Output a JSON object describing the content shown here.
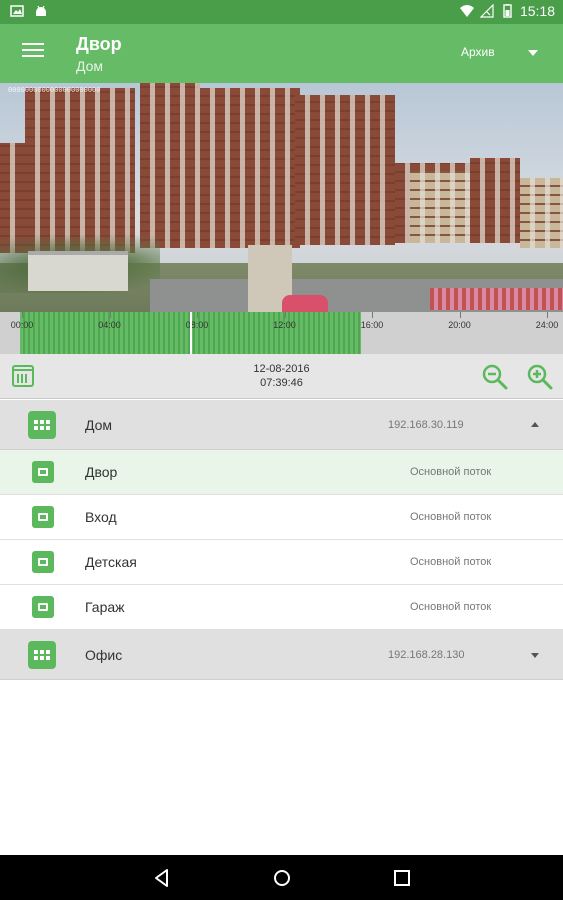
{
  "status_bar": {
    "time": "15:18",
    "icons": [
      "image-icon",
      "android-icon",
      "wifi-icon",
      "no-signal-icon",
      "battery-icon"
    ]
  },
  "app_bar": {
    "title": "Двор",
    "subtitle": "Дом",
    "archive_label": "Архив",
    "menu_icon": "hamburger-menu-icon"
  },
  "video": {
    "stamp": "0000000000000000000000"
  },
  "timeline": {
    "labels": [
      "00:00",
      "04:00",
      "08:00",
      "12:00",
      "16:00",
      "20:00",
      "24:00"
    ],
    "recording_hours": [
      0.2,
      15.5
    ],
    "cursor_hour": 7.66
  },
  "date_bar": {
    "date": "12-08-2016",
    "time": "07:39:46"
  },
  "tree": {
    "groups": [
      {
        "name": "Дом",
        "ip": "192.168.30.119",
        "expanded": true,
        "cameras": [
          {
            "name": "Двор",
            "stream": "Основной поток",
            "active": true
          },
          {
            "name": "Вход",
            "stream": "Основной поток",
            "active": false
          },
          {
            "name": "Детская",
            "stream": "Основной поток",
            "active": false
          },
          {
            "name": "Гараж",
            "stream": "Основной поток",
            "active": false
          }
        ]
      },
      {
        "name": "Офис",
        "ip": "192.168.28.130",
        "expanded": false,
        "cameras": []
      }
    ]
  },
  "colors": {
    "status_bar": "#4a9e4a",
    "app_bar": "#66bb66",
    "accent": "#5cb85c",
    "active_row": "#e8f5e8"
  }
}
